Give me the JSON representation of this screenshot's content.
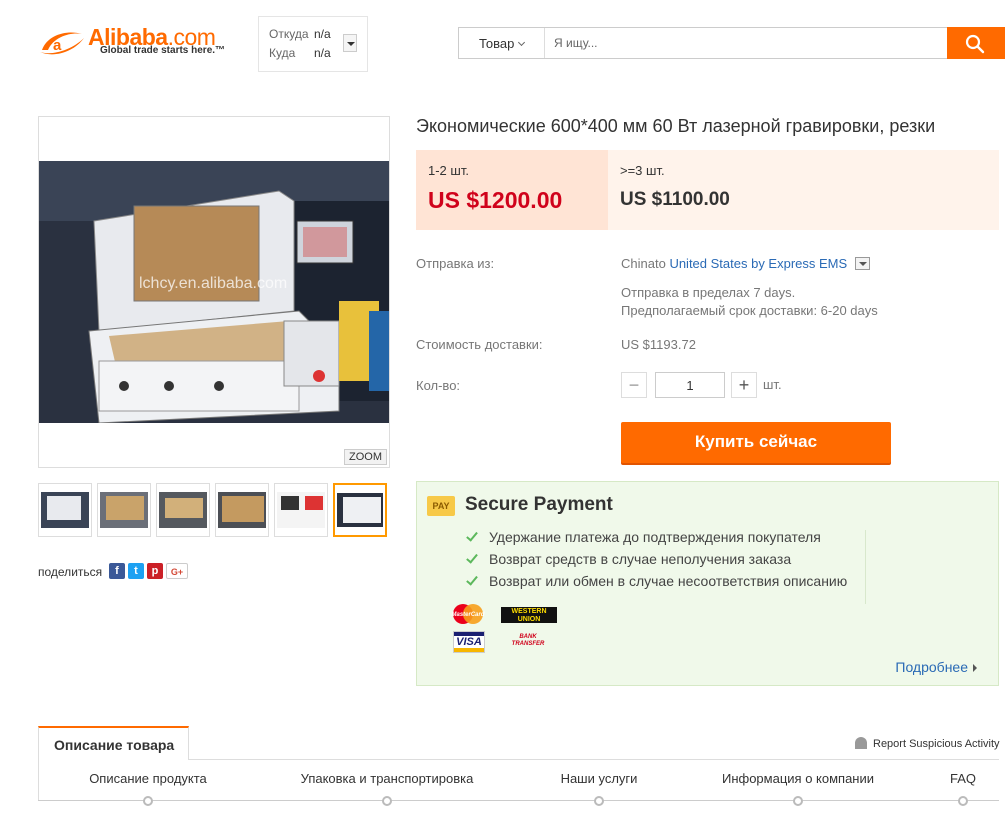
{
  "header": {
    "logo_text": "Alibaba",
    "logo_domain": ".com",
    "logo_tagline": "Global trade starts here.™",
    "route": {
      "from_label": "Откуда",
      "from_value": "n/a",
      "to_label": "Куда",
      "to_value": "n/a"
    },
    "search": {
      "category": "Товар",
      "placeholder": "Я ищу...",
      "button_icon": "search-icon"
    }
  },
  "gallery": {
    "zoom_label": "ZOOM",
    "watermark": "lchcy.en.alibaba.com",
    "thumbnail_count": 6,
    "active_thumbnail": 6
  },
  "share": {
    "label": "поделиться",
    "icons": [
      "facebook-icon",
      "twitter-icon",
      "pinterest-icon",
      "google-plus-icon"
    ]
  },
  "product": {
    "title": "Экономические 600*400 мм 60 Вт лазерной гравировки, резки",
    "tiers": [
      {
        "qty": "1-2 шт.",
        "price": "US $1200.00"
      },
      {
        "qty": ">=3 шт.",
        "price": "US $1100.00"
      }
    ],
    "shipping": {
      "label": "Отправка из:",
      "from": "China",
      "to_text": "to",
      "method": "United States by Express EMS",
      "ship_within": "Отправка в пределах 7 days.",
      "delivery_time": "Предполагаемый срок доставки: 6-20 days"
    },
    "shipping_cost": {
      "label": "Стоимость доставки:",
      "value": "US $1193.72"
    },
    "quantity": {
      "label": "Кол-во:",
      "value": "1",
      "unit": "шт.",
      "minus": "−",
      "plus": "+"
    },
    "buy_label": "Купить сейчас"
  },
  "secure_payment": {
    "badge": "PAY",
    "title": "Secure Payment",
    "items": [
      "Удержание платежа до подтверждения покупателя",
      "Возврат средств в случае неполучения заказа",
      "Возврат или обмен в случае несоответствия описанию"
    ],
    "methods": [
      "MasterCard",
      "WESTERN UNION",
      "VISA",
      "BANK TRANSFER"
    ],
    "more_label": "Подробнее"
  },
  "tabs": {
    "active": "Описание товара",
    "report": "Report Suspicious Activity",
    "nav": [
      "Описание продукта",
      "Упаковка и транспортировка",
      "Наши услуги",
      "Информация о компании",
      "FAQ"
    ]
  },
  "colors": {
    "accent": "#ff6a00",
    "price_red": "#d0021b",
    "link": "#2a6ab5",
    "secure_bg": "#f0f9ea"
  }
}
